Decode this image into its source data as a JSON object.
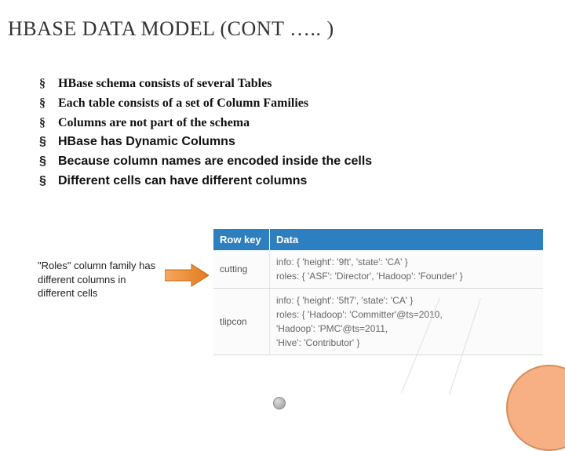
{
  "title": "HBASE DATA MODEL  (CONT ….. )",
  "bullets": [
    {
      "text": "HBase schema consists of several Tables",
      "style": "serif-bold"
    },
    {
      "text": "Each table consists of a set of Column Families",
      "style": "serif-bold"
    },
    {
      "text": "Columns are not part of the schema",
      "style": "serif-bold"
    },
    {
      "text": "HBase has Dynamic Columns",
      "style": "sans-bold"
    },
    {
      "text": "Because column names are encoded inside the cells",
      "style": "sans-bold"
    },
    {
      "text": "Different cells can have different columns",
      "style": "sans-bold"
    }
  ],
  "caption": "\"Roles\" column family has different columns in different cells",
  "table": {
    "headers": {
      "col1": "Row key",
      "col2": "Data"
    },
    "rows": [
      {
        "key": "cutting",
        "lines": [
          "info: { 'height': '9ft', 'state': 'CA' }",
          "roles: { 'ASF': 'Director', 'Hadoop': 'Founder' }"
        ]
      },
      {
        "key": "tlipcon",
        "lines": [
          "info: { 'height': '5ft7', 'state': 'CA' }",
          "roles: { 'Hadoop': 'Committer'@ts=2010,",
          "             'Hadoop': 'PMC'@ts=2011,",
          "             'Hive': 'Contributor' }"
        ]
      }
    ]
  },
  "icons": {
    "arrow": "arrow-right-icon"
  }
}
